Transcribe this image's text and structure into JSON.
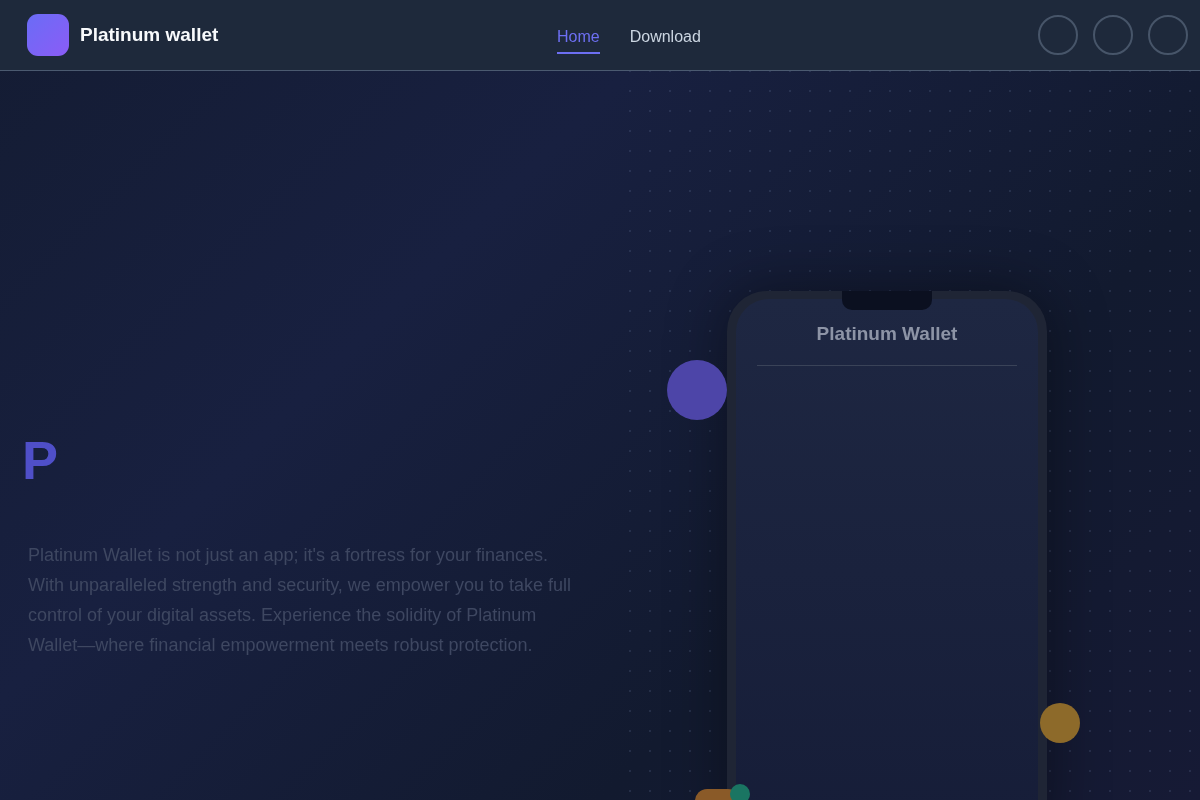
{
  "brand": {
    "name": "Platinum wallet"
  },
  "nav": [
    {
      "label": "Home",
      "selected": true
    },
    {
      "label": "Download",
      "selected": false
    }
  ],
  "hero": {
    "heading": "P",
    "description": "Platinum Wallet is not just an app; it's a fortress for your finances. With unparalleled strength and security, we empower you to take full control of your digital assets. Experience the solidity of Platinum Wallet—where financial empowerment meets robust protection."
  },
  "phone": {
    "title": "Platinum Wallet"
  }
}
